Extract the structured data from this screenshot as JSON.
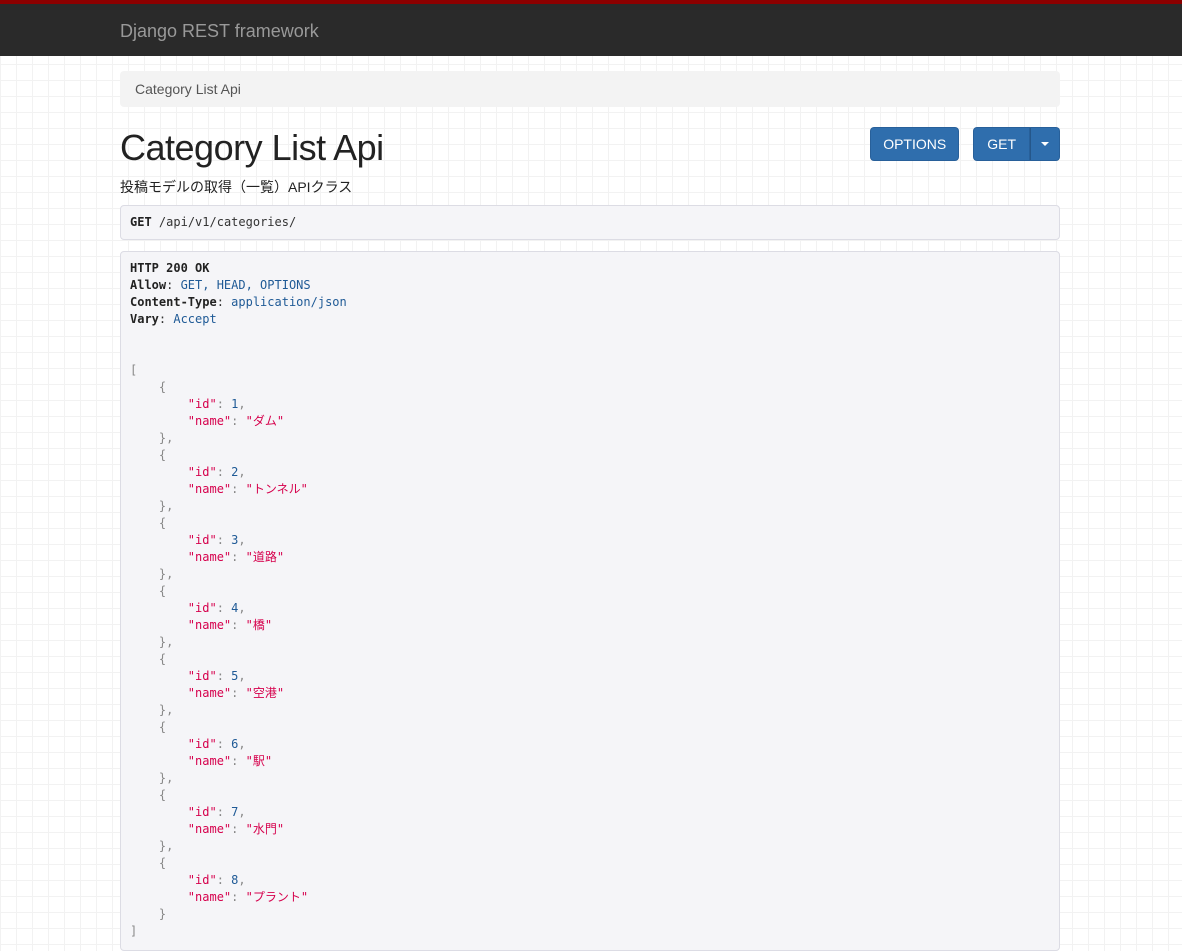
{
  "navbar": {
    "brand": "Django REST framework"
  },
  "breadcrumb": {
    "current": "Category List Api"
  },
  "page": {
    "title": "Category List Api",
    "description": "投稿モデルの取得（一覧）APIクラス"
  },
  "buttons": {
    "options": "OPTIONS",
    "get": "GET"
  },
  "request": {
    "method": "GET",
    "path": "/api/v1/categories/"
  },
  "response": {
    "status": "HTTP 200 OK",
    "headers": [
      {
        "name": "Allow",
        "value": "GET, HEAD, OPTIONS"
      },
      {
        "name": "Content-Type",
        "value": "application/json"
      },
      {
        "name": "Vary",
        "value": "Accept"
      }
    ],
    "body": [
      {
        "id": 1,
        "name": "ダム"
      },
      {
        "id": 2,
        "name": "トンネル"
      },
      {
        "id": 3,
        "name": "道路"
      },
      {
        "id": 4,
        "name": "橋"
      },
      {
        "id": 5,
        "name": "空港"
      },
      {
        "id": 6,
        "name": "駅"
      },
      {
        "id": 7,
        "name": "水門"
      },
      {
        "id": 8,
        "name": "プラント"
      }
    ]
  }
}
